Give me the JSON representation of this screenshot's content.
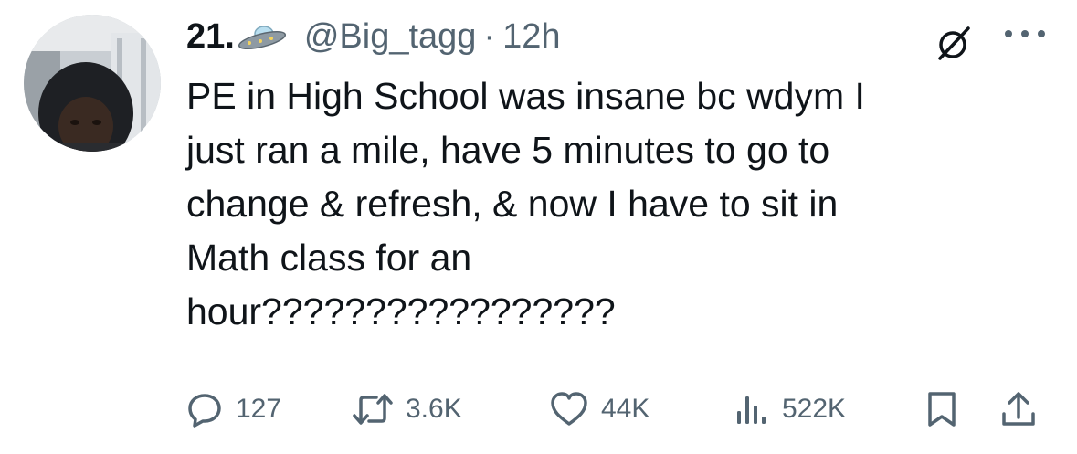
{
  "author": {
    "display_name": "21.",
    "badge_icon": "ufo-icon",
    "handle": "@Big_tagg",
    "separator": "·",
    "time": "12h"
  },
  "header_icons": {
    "grok": "grok-icon",
    "more": "more-icon"
  },
  "tweet": {
    "lines": [
      "PE in High School was insane bc wdym I",
      "just ran a mile, have 5 minutes to go to",
      "change & refresh, & now I have to sit in",
      "Math class for an",
      "hour?????????????????"
    ]
  },
  "actions": {
    "reply": {
      "icon": "reply-icon",
      "count": "127"
    },
    "retweet": {
      "icon": "retweet-icon",
      "count": "3.6K"
    },
    "like": {
      "icon": "heart-icon",
      "count": "44K"
    },
    "views": {
      "icon": "views-icon",
      "count": "522K"
    },
    "bookmark": {
      "icon": "bookmark-icon"
    },
    "share": {
      "icon": "share-icon"
    }
  },
  "colors": {
    "text_primary": "#0f1419",
    "text_secondary": "#536471",
    "background": "#ffffff"
  }
}
